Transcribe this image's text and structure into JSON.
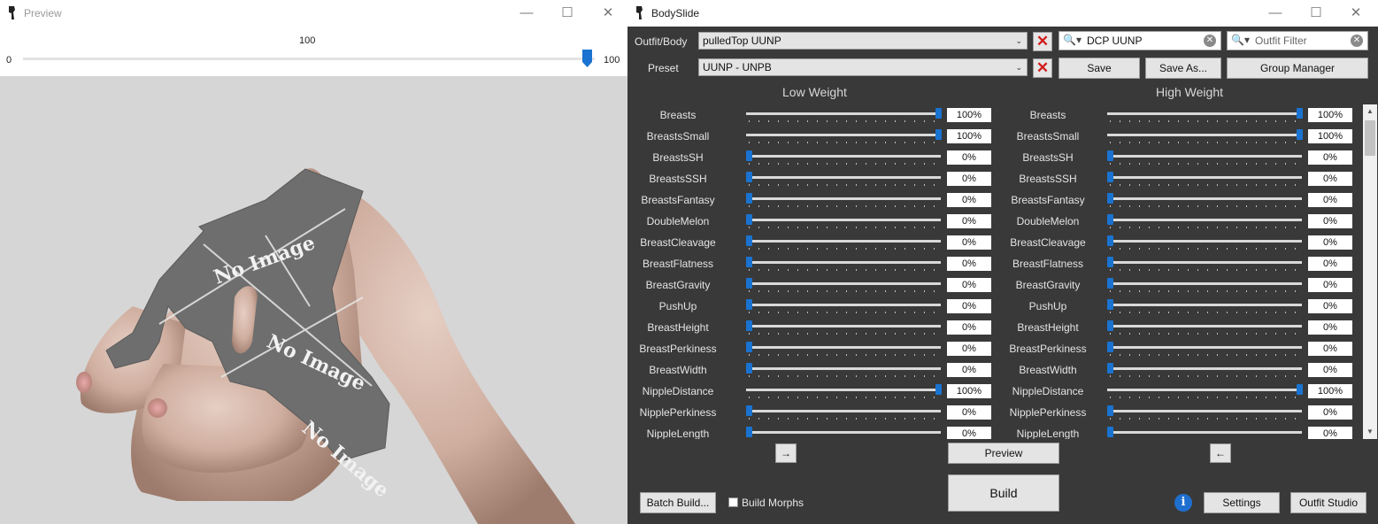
{
  "preview_window": {
    "title": "Preview",
    "slider": {
      "value": "100",
      "min": "0",
      "max": "100"
    },
    "image_text": "No Image"
  },
  "bodyslide": {
    "title": "BodySlide",
    "outfit_label": "Outfit/Body",
    "outfit_value": "pulledTop UUNP",
    "preset_label": "Preset",
    "preset_value": "UUNP - UNPB",
    "group_filter_value": "DCP UUNP",
    "outfit_filter_placeholder": "Outfit Filter",
    "save_label": "Save",
    "save_as_label": "Save As...",
    "group_manager_label": "Group Manager",
    "low_weight_label": "Low Weight",
    "high_weight_label": "High Weight",
    "sliders": [
      {
        "name": "Breasts",
        "low": "100%",
        "high": "100%",
        "low_level": 1.0,
        "high_level": 1.0
      },
      {
        "name": "BreastsSmall",
        "low": "100%",
        "high": "100%",
        "low_level": 1.0,
        "high_level": 1.0
      },
      {
        "name": "BreastsSH",
        "low": "0%",
        "high": "0%",
        "low_level": 0,
        "high_level": 0
      },
      {
        "name": "BreastsSSH",
        "low": "0%",
        "high": "0%",
        "low_level": 0,
        "high_level": 0
      },
      {
        "name": "BreastsFantasy",
        "low": "0%",
        "high": "0%",
        "low_level": 0,
        "high_level": 0
      },
      {
        "name": "DoubleMelon",
        "low": "0%",
        "high": "0%",
        "low_level": 0,
        "high_level": 0
      },
      {
        "name": "BreastCleavage",
        "low": "0%",
        "high": "0%",
        "low_level": 0,
        "high_level": 0
      },
      {
        "name": "BreastFlatness",
        "low": "0%",
        "high": "0%",
        "low_level": 0,
        "high_level": 0
      },
      {
        "name": "BreastGravity",
        "low": "0%",
        "high": "0%",
        "low_level": 0,
        "high_level": 0
      },
      {
        "name": "PushUp",
        "low": "0%",
        "high": "0%",
        "low_level": 0,
        "high_level": 0
      },
      {
        "name": "BreastHeight",
        "low": "0%",
        "high": "0%",
        "low_level": 0,
        "high_level": 0
      },
      {
        "name": "BreastPerkiness",
        "low": "0%",
        "high": "0%",
        "low_level": 0,
        "high_level": 0
      },
      {
        "name": "BreastWidth",
        "low": "0%",
        "high": "0%",
        "low_level": 0,
        "high_level": 0
      },
      {
        "name": "NippleDistance",
        "low": "100%",
        "high": "100%",
        "low_level": 1.0,
        "high_level": 1.0
      },
      {
        "name": "NipplePerkiness",
        "low": "0%",
        "high": "0%",
        "low_level": 0,
        "high_level": 0
      },
      {
        "name": "NippleLength",
        "low": "0%",
        "high": "0%",
        "low_level": 0,
        "high_level": 0
      }
    ],
    "copy_right_arrow": "→",
    "copy_left_arrow": "←",
    "preview_label": "Preview",
    "build_label": "Build",
    "batch_build_label": "Batch Build...",
    "build_morphs_label": "Build Morphs",
    "settings_label": "Settings",
    "outfit_studio_label": "Outfit Studio"
  },
  "colors": {
    "slider_accent": "#1a73d0",
    "panel_bg": "#393939",
    "close_x": "#d21c1c"
  }
}
